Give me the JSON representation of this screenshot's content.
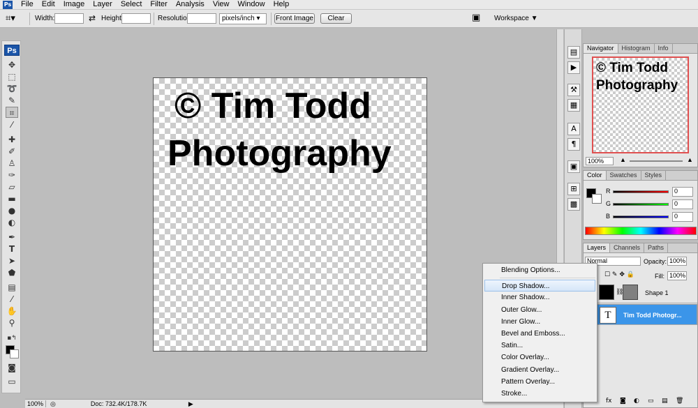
{
  "menubar": {
    "app_logo": "Ps",
    "items": [
      "File",
      "Edit",
      "Image",
      "Layer",
      "Select",
      "Filter",
      "Analysis",
      "View",
      "Window",
      "Help"
    ]
  },
  "options": {
    "width_label": "Width:",
    "height_label": "Height:",
    "resolution_label": "Resolution:",
    "unit": "pixels/inch",
    "front_image": "Front Image",
    "clear": "Clear",
    "workspace": "Workspace ▼"
  },
  "toolbox": {
    "logo": "Ps"
  },
  "canvas": {
    "line1": "© Tim Todd",
    "line2": "Photography"
  },
  "status": {
    "zoom": "100%",
    "doc": "Doc: 732.4K/178.7K"
  },
  "navigator": {
    "tabs": [
      "Navigator",
      "Histogram",
      "Info"
    ],
    "thumb_line1": "© Tim Todd",
    "thumb_line2": "Photography",
    "zoom": "100%"
  },
  "color": {
    "tabs": [
      "Color",
      "Swatches",
      "Styles"
    ],
    "r_label": "R",
    "g_label": "G",
    "b_label": "B",
    "r": "0",
    "g": "0",
    "b": "0"
  },
  "layers": {
    "tabs": [
      "Layers",
      "Channels",
      "Paths"
    ],
    "blend_mode": "Normal",
    "opacity_label": "Opacity:",
    "opacity": "100%",
    "fill_label": "Fill:",
    "fill": "100%",
    "rows": [
      {
        "name": "Shape 1"
      },
      {
        "name": "Tim Todd Photogr..."
      }
    ]
  },
  "context_menu": {
    "items": [
      "Blending Options...",
      "Drop Shadow...",
      "Inner Shadow...",
      "Outer Glow...",
      "Inner Glow...",
      "Bevel and Emboss...",
      "Satin...",
      "Color Overlay...",
      "Gradient Overlay...",
      "Pattern Overlay...",
      "Stroke..."
    ]
  }
}
